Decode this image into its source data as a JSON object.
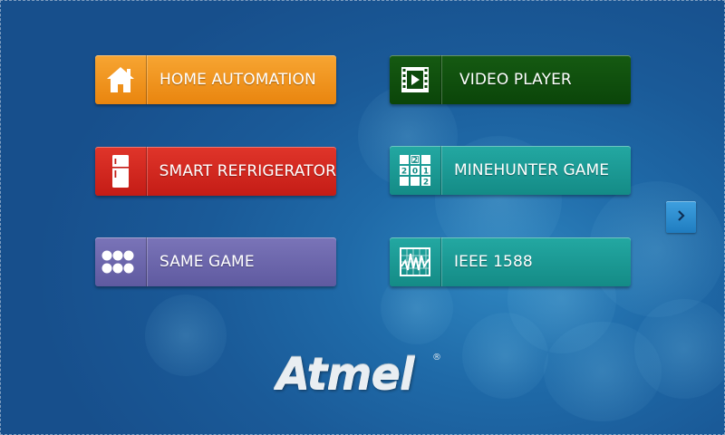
{
  "tiles": [
    {
      "label": "HOME AUTOMATION",
      "icon": "house-icon",
      "color": "#e9850e"
    },
    {
      "label": "VIDEO PLAYER",
      "icon": "film-play-icon",
      "color": "#0b4509"
    },
    {
      "label": "SMART REFRIGERATOR",
      "icon": "refrigerator-icon",
      "color": "#c41c16"
    },
    {
      "label": "MINEHUNTER GAME",
      "icon": "minesweeper-grid-icon",
      "color": "#148b86"
    },
    {
      "label": "SAME GAME",
      "icon": "dots-grid-icon",
      "color": "#5f5aa0"
    },
    {
      "label": "IEEE 1588",
      "icon": "waveform-chart-icon",
      "color": "#148b86"
    }
  ],
  "minegrid": [
    "",
    "2",
    "",
    "2",
    "0",
    "1",
    "",
    "",
    "2"
  ],
  "next_button": {
    "icon": "chevron-right-icon"
  },
  "logo": {
    "text": "Atmel",
    "registered": "®"
  }
}
